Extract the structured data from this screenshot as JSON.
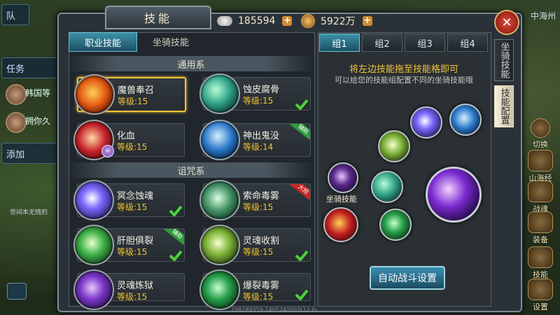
{
  "window": {
    "title": "技能"
  },
  "currency": {
    "silver": "185594",
    "gold": "5922万"
  },
  "close_label": "✕",
  "top_tabs": [
    {
      "label": "职业技能",
      "active": true
    },
    {
      "label": "坐骑技能",
      "active": false
    }
  ],
  "sections": [
    {
      "title": "通用系",
      "skills": [
        {
          "name": "魔兽奉召",
          "level": "等级:15",
          "selected": true,
          "checked": false,
          "tag": "",
          "icon": "fire-beast-icon"
        },
        {
          "name": "蚀皮腐骨",
          "level": "等级:15",
          "selected": false,
          "checked": true,
          "tag": "",
          "icon": "green-spiral-icon"
        },
        {
          "name": "化血",
          "level": "等级:15",
          "selected": false,
          "checked": false,
          "tag": "",
          "icon": "blood-swirl-icon"
        },
        {
          "name": "神出鬼没",
          "level": "等级:14",
          "selected": false,
          "checked": false,
          "tag": "辅助",
          "icon": "blue-ghost-icon"
        }
      ]
    },
    {
      "title": "诅咒系",
      "skills": [
        {
          "name": "冥念蚀魂",
          "level": "等级:15",
          "selected": false,
          "checked": true,
          "tag": "",
          "icon": "purple-soul-icon"
        },
        {
          "name": "索命毒雾",
          "level": "等级:15",
          "selected": false,
          "checked": false,
          "tag": "大招",
          "icon": "skull-mist-icon"
        },
        {
          "name": "肝胆俱裂",
          "level": "等级:15",
          "selected": false,
          "checked": true,
          "tag": "辅助",
          "icon": "lightning-icon"
        },
        {
          "name": "灵魂收割",
          "level": "等级:15",
          "selected": false,
          "checked": true,
          "tag": "",
          "icon": "green-reap-icon"
        },
        {
          "name": "灵魂炼狱",
          "level": "等级:15",
          "selected": false,
          "checked": false,
          "tag": "",
          "icon": "purple-purgatory-icon"
        },
        {
          "name": "爆裂毒雾",
          "level": "等级:15",
          "selected": false,
          "checked": true,
          "tag": "",
          "icon": "toxic-burst-icon"
        }
      ]
    }
  ],
  "group_tabs": [
    {
      "label": "组1",
      "active": true
    },
    {
      "label": "组2"
    },
    {
      "label": "组3"
    },
    {
      "label": "组4"
    }
  ],
  "hint_main": "将左边技能拖至技能格即可",
  "hint_sub": "可以给您的技能组配置不同的坐骑技能哦",
  "mount_label": "坐骑技能",
  "auto_battle_label": "自动战斗设置",
  "side_tabs": [
    {
      "label": "坐骑技能",
      "active": false
    },
    {
      "label": "技能配置",
      "active": true
    }
  ],
  "hud": {
    "left_items": [
      "队",
      "任务",
      "韩国等",
      "拥你久",
      "添加",
      "世间本无情的"
    ],
    "right_items": [
      "切换",
      "山海经",
      "战魂",
      "装备",
      "技能",
      "设置"
    ],
    "map_name": "中海州"
  },
  "bottom_text": "298289359·1405240003(12·6)",
  "colors": {
    "accent": "#f0c13a",
    "tab_active": "#3b90a8",
    "level": "#f2c232"
  }
}
